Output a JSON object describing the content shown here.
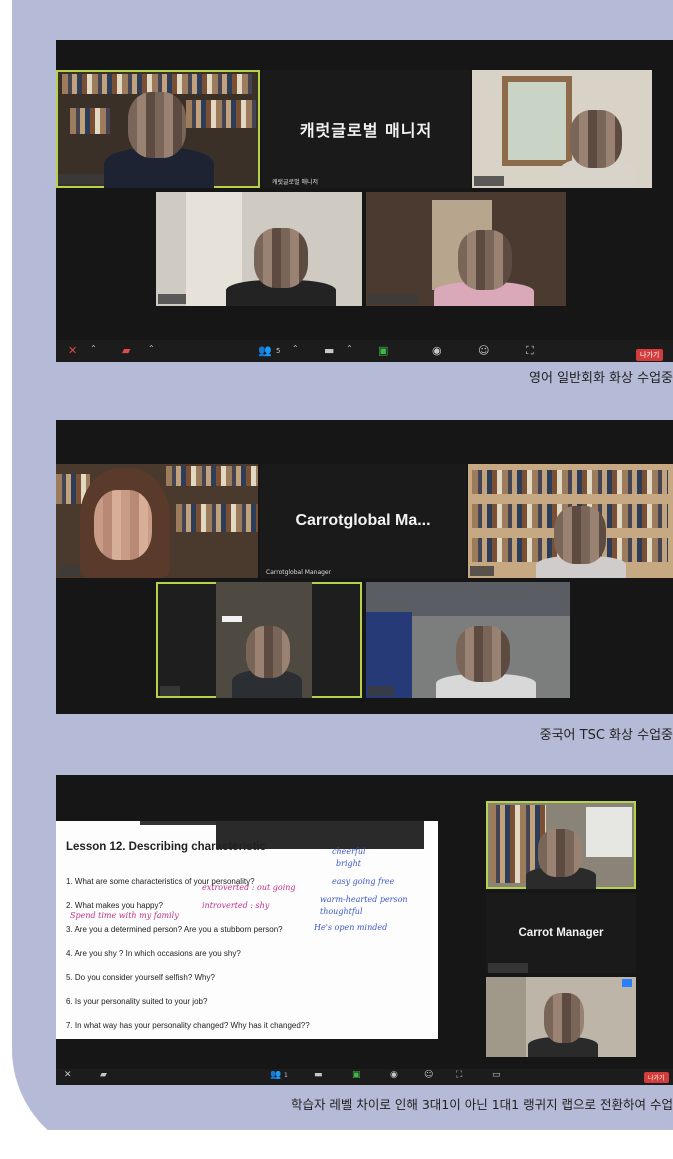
{
  "section1": {
    "name_card": "캐럿글로벌 매니저",
    "name_label": "캐럿글로벌 매니저",
    "participants_count": "5",
    "leave_button": "나가기",
    "caption": "영어 일반회화 화상 수업중"
  },
  "section2": {
    "name_card": "Carrotglobal  Ma...",
    "name_label": "Carrotglobal Manager",
    "caption": "중국어 TSC 화상 수업중"
  },
  "section3": {
    "lesson_title": "Lesson 12. Describing characteristic",
    "questions": [
      "1. What are some characteristics of your personality?",
      "2. What makes you happy?",
      "3. Are you a determined person? Are you a stubborn person?",
      "4. Are you shy ? In which occasions are you shy?",
      "5. Do you consider yourself selfish? Why?",
      "6. Is your personality suited to your job?",
      "7. In what way has your personality changed? Why has it changed??"
    ],
    "annotations": {
      "cheerful": "cheerful",
      "bright": "bright",
      "easy_going": "easy going  free",
      "warm_hearted": "warm-hearted  person",
      "thoughtful": "thoughtful",
      "open_minded": "He's  open minded",
      "extroverted": "extroverted : out going",
      "introverted": "introverted : shy",
      "spend_time": "Spend time with my family"
    },
    "name_card": "Carrot Manager",
    "participants_count": "1",
    "leave_button": "나가기",
    "caption": "학습자 레벨 차이로 인해 3대1이 아닌 1대1 랭귀지 랩으로 전환하여 수업"
  }
}
